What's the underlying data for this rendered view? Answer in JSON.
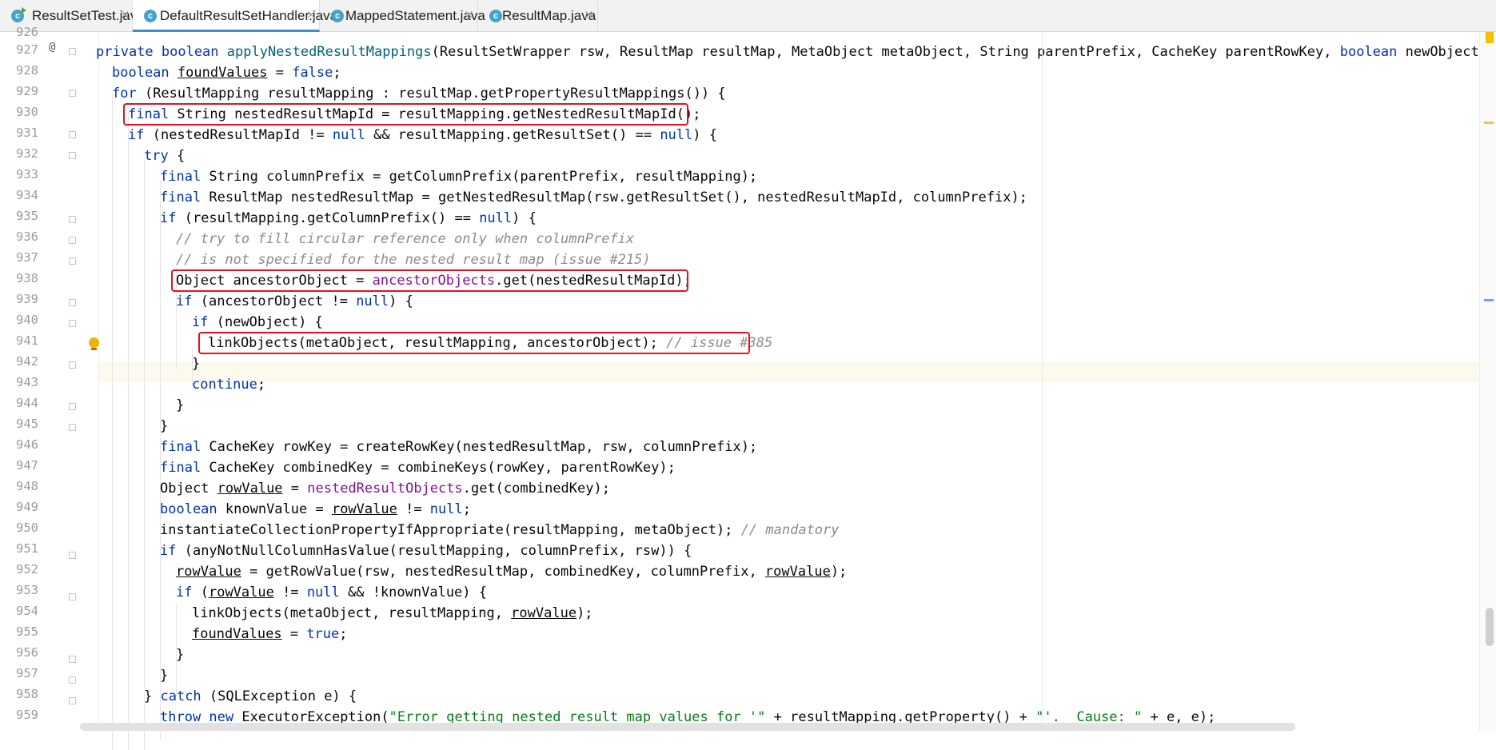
{
  "tabs": [
    {
      "label": "ResultSetTest.java",
      "icon": "java-class-run-icon",
      "active": false
    },
    {
      "label": "DefaultResultSetHandler.java",
      "icon": "java-class-icon",
      "active": true
    },
    {
      "label": "MappedStatement.java",
      "icon": "java-class-icon",
      "active": false
    },
    {
      "label": "ResultMap.java",
      "icon": "java-class-icon",
      "active": false
    }
  ],
  "tab_icon_letter": "c",
  "close_glyph": "×",
  "gutter": {
    "top_partial": "926",
    "line_numbers": [
      "927",
      "928",
      "929",
      "930",
      "931",
      "932",
      "933",
      "934",
      "935",
      "936",
      "937",
      "938",
      "939",
      "940",
      "941",
      "942",
      "943",
      "944",
      "945",
      "946",
      "947",
      "948",
      "949",
      "950",
      "951",
      "952",
      "953",
      "954",
      "955",
      "956",
      "957",
      "958",
      "959"
    ],
    "annotation_icon": "@",
    "intention_bulb_line": "941"
  },
  "code": {
    "l927": {
      "kw1": "private boolean ",
      "meth": "applyNestedResultMappings",
      "t1": "(ResultSetWrapper rsw, ResultMap resultMap, MetaObject metaObject, String parentPrefix, CacheKey parentRowKey, ",
      "kw2": "boolean ",
      "t2": "newObject) {"
    },
    "l928": {
      "kw": "boolean ",
      "ul": "foundValues",
      "t": " = ",
      "kw2": "false",
      "t2": ";"
    },
    "l929": {
      "kw": "for ",
      "t": "(ResultMapping resultMapping : resultMap.getPropertyResultMappings()) {"
    },
    "l930": {
      "kw": "final ",
      "t": "String nestedResultMapId = resultMapping.getNestedResultMapId();"
    },
    "l931": {
      "kw": "if ",
      "t": "(nestedResultMapId != ",
      "kw2": "null ",
      "t2": "&& resultMapping.getResultSet() == ",
      "kw3": "null",
      "t3": ") {"
    },
    "l932": {
      "kw": "try ",
      "t": "{"
    },
    "l933": {
      "kw": "final ",
      "t": "String columnPrefix = getColumnPrefix(parentPrefix, resultMapping);"
    },
    "l934": {
      "kw": "final ",
      "t": "ResultMap nestedResultMap = getNestedResultMap(rsw.getResultSet(), nestedResultMapId, columnPrefix);"
    },
    "l935": {
      "kw": "if ",
      "t": "(resultMapping.getColumnPrefix() == ",
      "kw2": "null",
      "t2": ") {"
    },
    "l936": {
      "cm": "// try to fill circular reference only when columnPrefix"
    },
    "l937": {
      "cm": "// is not specified for the nested result map (issue #215)"
    },
    "l938": {
      "t": "Object ancestorObject = ",
      "fld": "ancestorObjects",
      "t2": ".get(nestedResultMapId);"
    },
    "l939": {
      "kw": "if ",
      "t": "(ancestorObject != ",
      "kw2": "null",
      "t2": ") {"
    },
    "l940": {
      "kw": "if ",
      "t": "(newObject) {"
    },
    "l941": {
      "t": "linkObjects(metaObject, resultMapping, ancestorObject); ",
      "cm": "// issue #385"
    },
    "l942": {
      "t": "}"
    },
    "l943": {
      "kw": "continue",
      "t": ";"
    },
    "l944": {
      "t": "}"
    },
    "l945": {
      "t": "}"
    },
    "l946": {
      "kw": "final ",
      "t": "CacheKey rowKey = createRowKey(nestedResultMap, rsw, columnPrefix);"
    },
    "l947": {
      "kw": "final ",
      "t": "CacheKey combinedKey = combineKeys(rowKey, parentRowKey);"
    },
    "l948": {
      "t": "Object ",
      "ul": "rowValue",
      "t2": " = ",
      "fld": "nestedResultObjects",
      "t3": ".get(combinedKey);"
    },
    "l949": {
      "kw": "boolean ",
      "t": "knownValue = ",
      "ul": "rowValue",
      "t2": " != ",
      "kw2": "null",
      "t3": ";"
    },
    "l950": {
      "t": "instantiateCollectionPropertyIfAppropriate(resultMapping, metaObject); ",
      "cm": "// mandatory"
    },
    "l951": {
      "kw": "if ",
      "t": "(anyNotNullColumnHasValue(resultMapping, columnPrefix, rsw)) {"
    },
    "l952": {
      "ul": "rowValue",
      "t": " = getRowValue(rsw, nestedResultMap, combinedKey, columnPrefix, ",
      "ul2": "rowValue",
      "t2": ");"
    },
    "l953": {
      "kw": "if ",
      "t": "(",
      "ul": "rowValue",
      "t2": " != ",
      "kw2": "null ",
      "t3": "&& !knownValue) {"
    },
    "l954": {
      "t": "linkObjects(metaObject, resultMapping, ",
      "ul": "rowValue",
      "t2": ");"
    },
    "l955": {
      "ul": "foundValues",
      "t": " = ",
      "kw": "true",
      "t2": ";"
    },
    "l956": {
      "t": "}"
    },
    "l957": {
      "t": "}"
    },
    "l958": {
      "t": "} ",
      "kw": "catch ",
      "t2": "(SQLException e) {"
    },
    "l959": {
      "kw": "throw new ",
      "t": "ExecutorException(",
      "str": "\"Error getting nested result map values for '\"",
      "t2": " + resultMapping.getProperty() + ",
      "str2": "\"'.  Cause: \"",
      "t3": " + e, e);"
    }
  },
  "colors": {
    "keyword": "#0033b3",
    "field": "#871094",
    "comment": "#8c8c8c",
    "string": "#067d17",
    "highlight_box": "#e8111a",
    "active_tab_underline": "#3d8ad8"
  }
}
